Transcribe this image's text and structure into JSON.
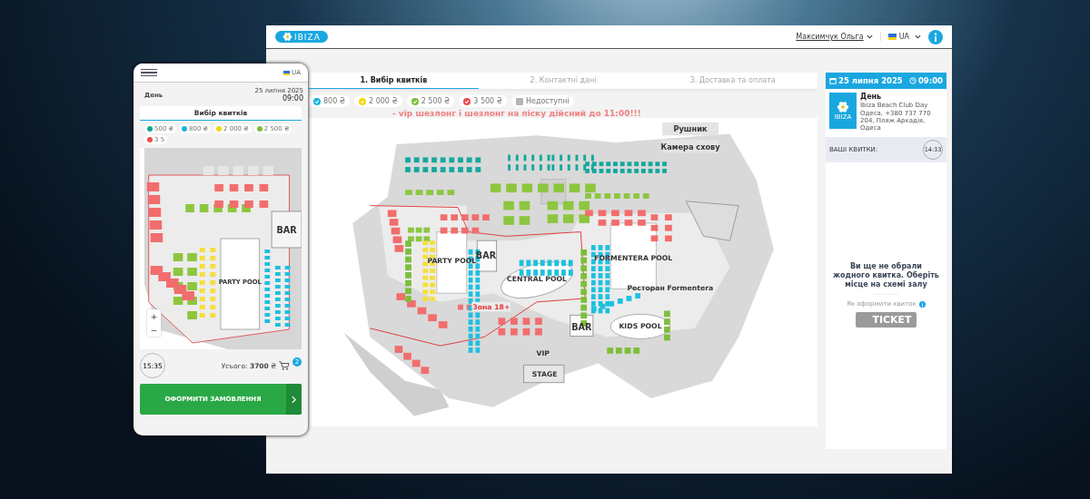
{
  "desktop": {
    "header": {
      "logo": "IBIZA",
      "user": "Максимчук Ольга",
      "language": "UA"
    },
    "steps": [
      {
        "label": "1. Вибір квитків",
        "selected": true
      },
      {
        "label": "2. Контактні дані",
        "selected": false
      },
      {
        "label": "3. Доставка та оплата",
        "selected": false
      }
    ],
    "legend": [
      {
        "kind": "price",
        "label": "800 ₴",
        "color": "#1ab4e0"
      },
      {
        "kind": "price",
        "label": "2 000 ₴",
        "color": "#f2d70c"
      },
      {
        "kind": "price",
        "label": "2 500 ₴",
        "color": "#7cbf3a"
      },
      {
        "kind": "price",
        "label": "3 500 ₴",
        "color": "#ef4b4b"
      },
      {
        "kind": "unavailable",
        "label": "Недоступні",
        "color": "#b5b5b5"
      }
    ],
    "notice": "- vip шезлонг і шезлонг на піску дійсний до 11:00!!!",
    "map_labels": [
      "Рушник",
      "Камера схову",
      "PARTY POOL",
      "BAR",
      "CENTRAL POOL",
      "FORMENTERA POOL",
      "BAR",
      "KIDS POOL",
      "VIP",
      "STAGE",
      "Ресторан Formentera",
      "Зона 18+"
    ],
    "sidebar": {
      "date": "25 липня 2025",
      "time": "09:00",
      "logo": "IBIZA",
      "event": "День",
      "venue": "Ibiza Beach Club Day",
      "address": "Одеса, +380 737 770 204, Пляж Аркадія, Одеса",
      "tickets_label": "ВАШІ КВИТКИ:",
      "timer": "14:33",
      "empty_message": "Ви ще не обрали жодного квитка. Оберіть місце на схемі залу",
      "how_to": "Як оформити квиток",
      "ticket": "TICKET"
    }
  },
  "mobile": {
    "language": "UA",
    "event": "День",
    "date": "25 липня 2025",
    "time": "09:00",
    "tab": "Вибір квитків",
    "legend": [
      {
        "label": "500 ₴",
        "color": "#12a594"
      },
      {
        "label": "800 ₴",
        "color": "#1ab4e0"
      },
      {
        "label": "2 000 ₴",
        "color": "#f2d70c"
      },
      {
        "label": "2 500 ₴",
        "color": "#7cbf3a"
      },
      {
        "label": "3 5",
        "color": "#ef4b4b"
      }
    ],
    "map_labels": [
      "PARTY POOL",
      "BAR"
    ],
    "zoom_in": "+",
    "zoom_out": "−",
    "timer": "15:35",
    "total": "Усього: **3700** ₴",
    "cart_count": "2",
    "order_button": "ОФОРМИТИ ЗАМОВЛЕННЯ"
  }
}
